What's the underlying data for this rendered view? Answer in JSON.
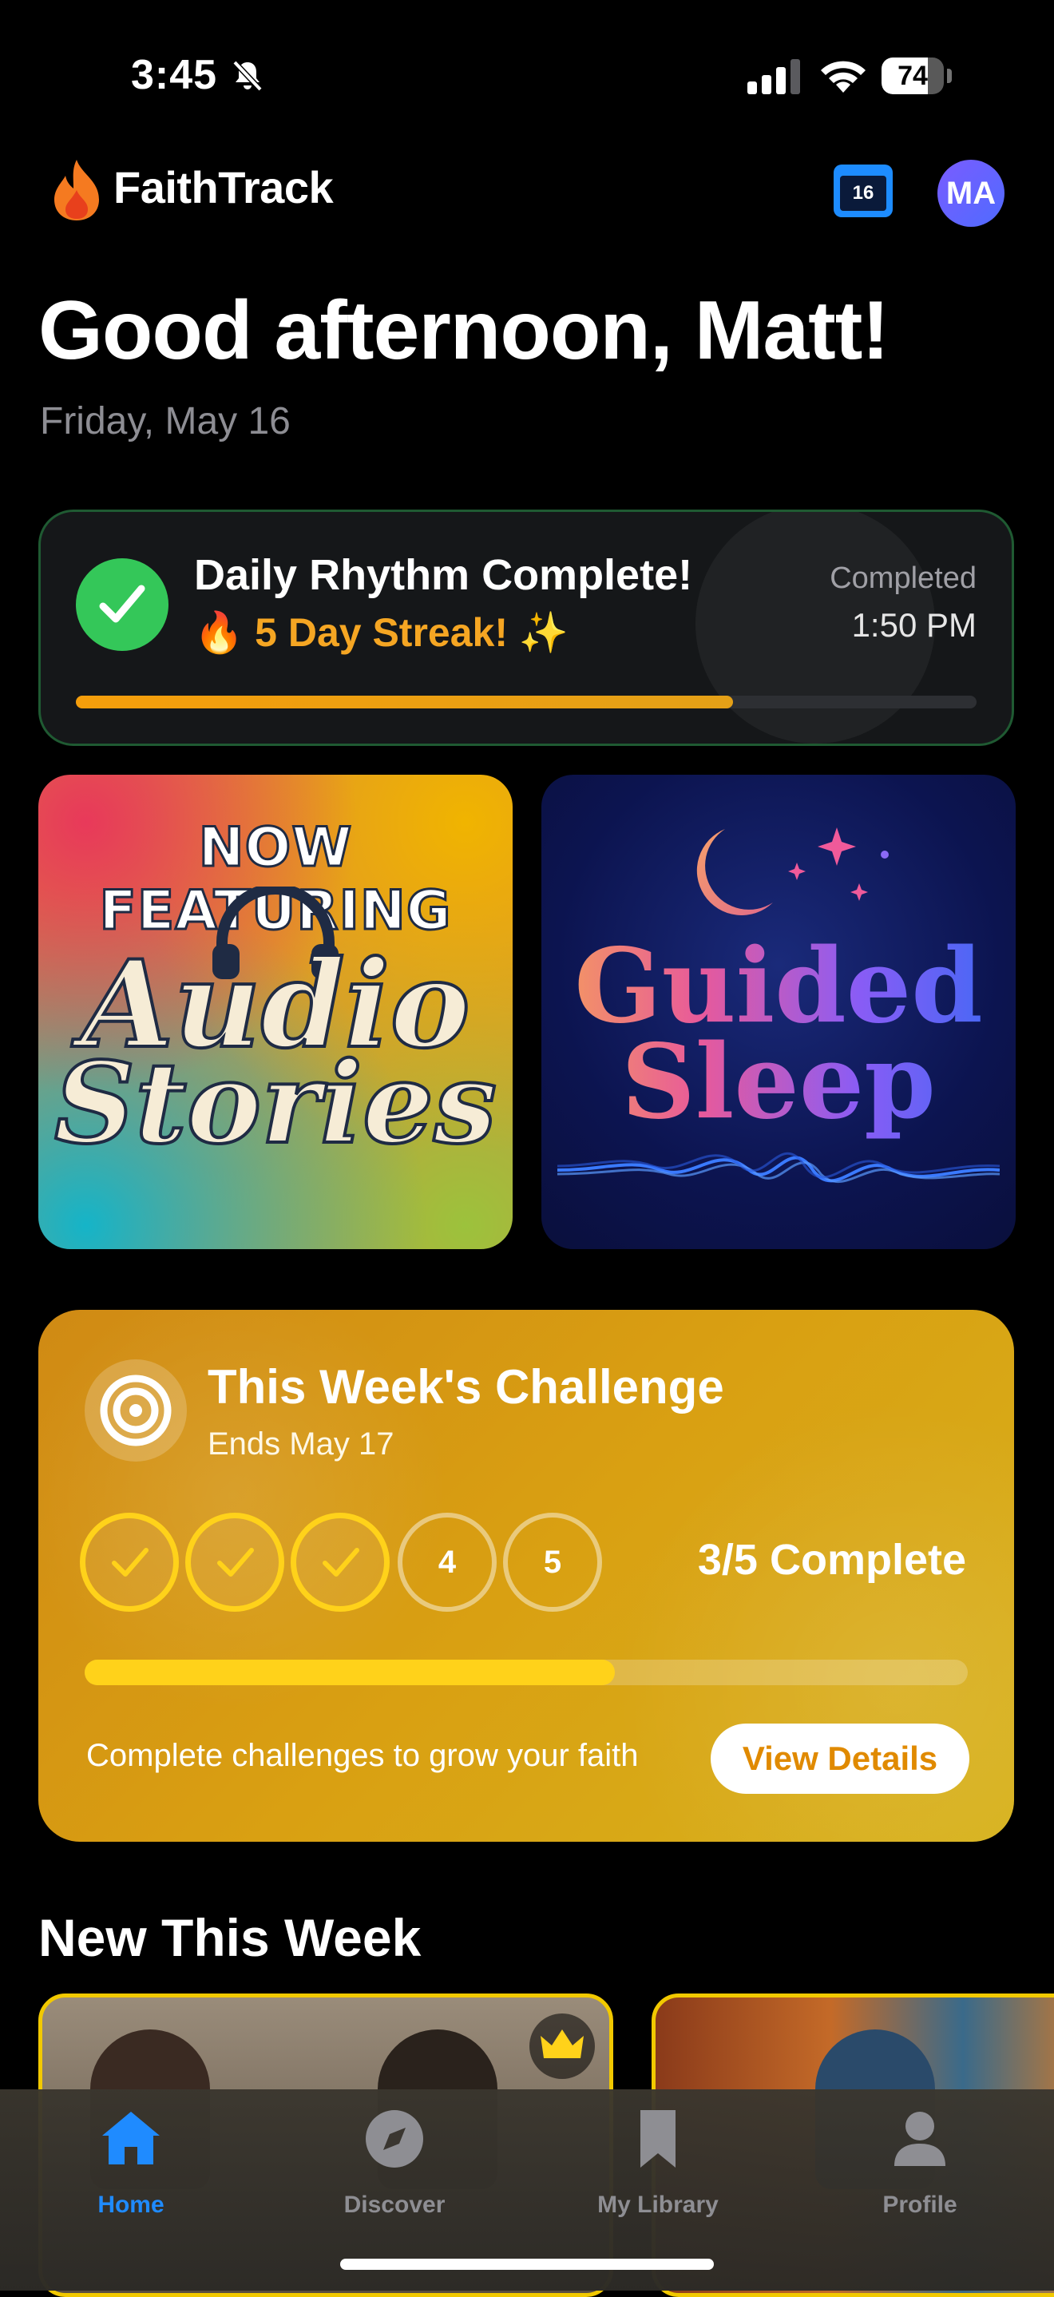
{
  "status_bar": {
    "time": "3:45",
    "battery": "74",
    "battery_level": 0.74
  },
  "header": {
    "app_name": "FaithTrack",
    "calendar_day": "16",
    "avatar_initials": "MA"
  },
  "greeting": "Good afternoon, Matt!",
  "date": "Friday, May 16",
  "daily_rhythm": {
    "title": "Daily Rhythm Complete!",
    "streak": "🔥 5 Day Streak! ✨",
    "completed_label": "Completed",
    "completed_time": "1:50 PM",
    "progress": 0.73
  },
  "features": [
    {
      "top": "NOW FEATURING",
      "line1": "Audio",
      "line2": "Stories"
    },
    {
      "line1": "Guided",
      "line2": "Sleep"
    }
  ],
  "challenge": {
    "title": "This Week's Challenge",
    "subtitle": "Ends May 17",
    "days": [
      "✓",
      "✓",
      "✓",
      "4",
      "5"
    ],
    "completed_days": 3,
    "status": "3/5 Complete",
    "progress": 0.6,
    "note": "Complete challenges to grow your faith",
    "button": "View Details"
  },
  "section": {
    "title": "New This Week"
  },
  "tabs": [
    {
      "label": "Home",
      "icon": "home-icon",
      "active": true
    },
    {
      "label": "Discover",
      "icon": "compass-icon",
      "active": false
    },
    {
      "label": "My Library",
      "icon": "bookmark-icon",
      "active": false
    },
    {
      "label": "Profile",
      "icon": "person-icon",
      "active": false
    }
  ],
  "colors": {
    "accent": "#1f8bff",
    "success": "#34c759",
    "streak": "#f5a623",
    "challenge_gold": "#ffd21a"
  }
}
